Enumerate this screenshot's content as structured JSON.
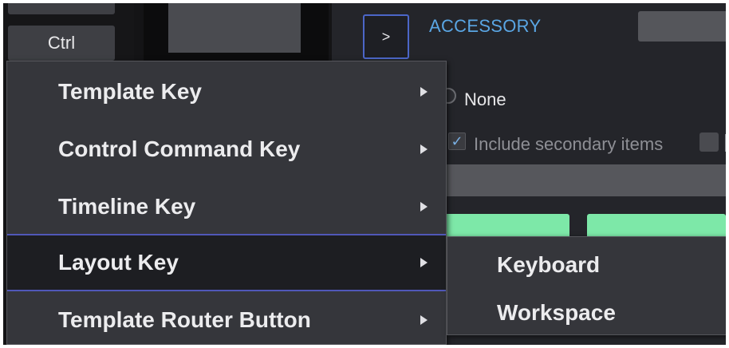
{
  "left_panel": {
    "top_key_label": "",
    "ctrl_key_label": "Ctrl"
  },
  "right_panel": {
    "expand_button_label": ">",
    "section_title": "ACCESSORY",
    "radio_none_label": "None",
    "include_secondary_label": "Include secondary items",
    "include_secondary_checked": true
  },
  "context_menu": {
    "items": [
      {
        "label": "Template Key",
        "has_submenu": true
      },
      {
        "label": "Control Command Key",
        "has_submenu": true
      },
      {
        "label": "Timeline Key",
        "has_submenu": true
      },
      {
        "label": "Layout Key",
        "has_submenu": true,
        "active": true
      },
      {
        "label": "Template Router Button",
        "has_submenu": true
      }
    ]
  },
  "submenu": {
    "items": [
      {
        "label": "Keyboard"
      },
      {
        "label": "Workspace"
      }
    ]
  },
  "colors": {
    "accent_blue": "#5aa6e4",
    "selection_border": "#5058b8",
    "green_button": "#7de8a8",
    "menu_bg": "#35363b"
  }
}
